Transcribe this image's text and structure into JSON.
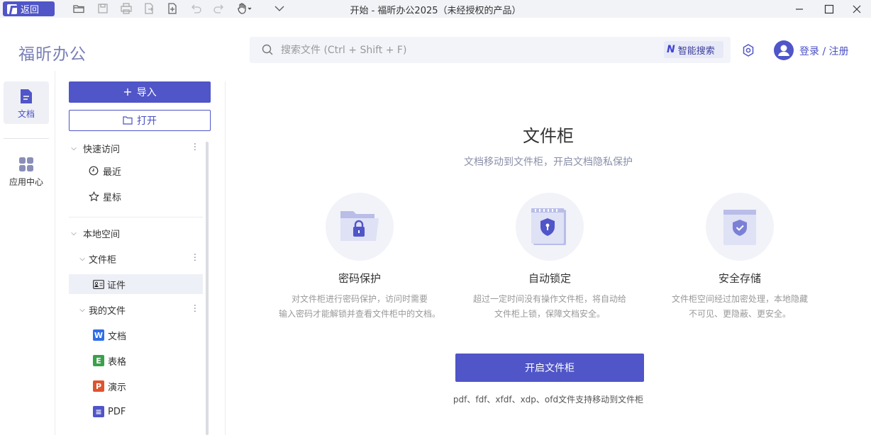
{
  "titlebar": {
    "back_label": "返回",
    "title": "开始 - 福昕办公2025（未经授权的产品）"
  },
  "header": {
    "app_name": "福昕办公",
    "search_placeholder": "搜索文件 (Ctrl + Shift + F)",
    "ai_search_label": "智能搜索",
    "login_label": "登录 / 注册"
  },
  "rail": {
    "items": [
      {
        "label": "文档",
        "icon": "document-icon",
        "active": true
      },
      {
        "label": "应用中心",
        "icon": "apps-grid-icon",
        "active": false
      }
    ]
  },
  "sidebar": {
    "import_label": "导入",
    "open_label": "打开",
    "quick_access": {
      "label": "快速访问",
      "items": [
        {
          "label": "最近",
          "icon": "clock-icon"
        },
        {
          "label": "星标",
          "icon": "star-icon"
        }
      ]
    },
    "local_space": {
      "label": "本地空间",
      "cabinet": {
        "label": "文件柜",
        "items": [
          {
            "label": "证件",
            "icon": "id-card-icon",
            "selected": true
          }
        ]
      },
      "my_files": {
        "label": "我的文件",
        "items": [
          {
            "label": "文档",
            "icon": "word-icon",
            "color": "#2f6fe8"
          },
          {
            "label": "表格",
            "icon": "excel-icon",
            "color": "#3aa14b"
          },
          {
            "label": "演示",
            "icon": "ppt-icon",
            "color": "#e0532f"
          },
          {
            "label": "PDF",
            "icon": "pdf-icon",
            "color": "#5055c8"
          }
        ]
      }
    }
  },
  "main": {
    "title": "文件柜",
    "subtitle": "文档移动到文件柜，开启文档隐私保护",
    "features": [
      {
        "title": "密码保护",
        "desc1": "对文件柜进行密码保护，访问时需要",
        "desc2": "输入密码才能解锁并查看文件柜中的文档。",
        "icon": "locked-folder-icon"
      },
      {
        "title": "自动锁定",
        "desc1": "超过一定时间没有操作文件柜，将自动给",
        "desc2": "文件柜上锁，保障文档安全。",
        "icon": "shield-calendar-icon"
      },
      {
        "title": "安全存储",
        "desc1": "文件柜空间经过加密处理，本地隐藏",
        "desc2": "不可见、更隐蔽、更安全。",
        "icon": "secure-storage-icon"
      }
    ],
    "enable_button": "开启文件柜",
    "formats_note": "pdf、fdf、xfdf、xdp、ofd文件支持移动到文件柜"
  },
  "colors": {
    "accent": "#5055c8",
    "icon_light": "#b9bde8"
  }
}
